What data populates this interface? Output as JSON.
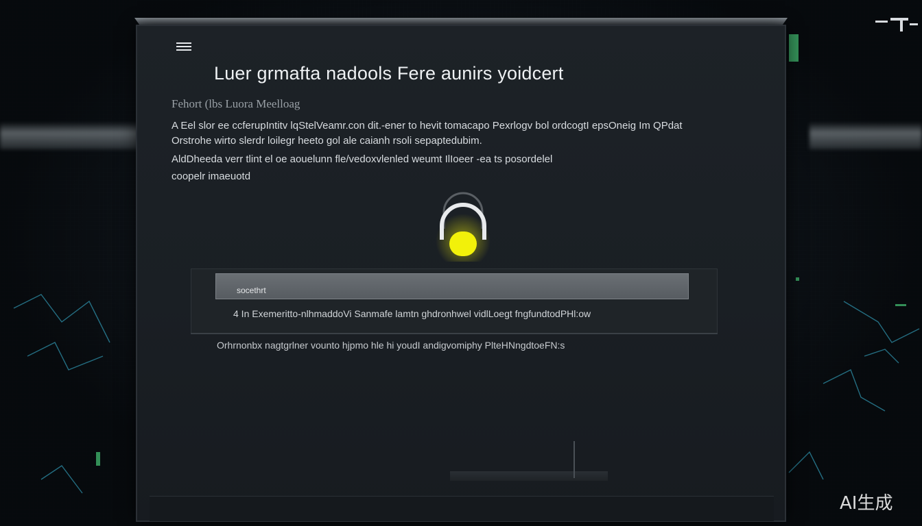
{
  "dialog": {
    "title": "Luer grmafta nadools Fere aunirs yoidcert",
    "subtitle": "Fehort (lbs Luora Meelloag",
    "paragraphs": [
      "A Eel slor ee ccferupIntitv lqStelVeamr.con dit.-ener to hevit tomacapo Pexrlogv bol ordcogtI epsOneig Im QPdat",
      "Orstrohe wirto slerdr loilegr heeto gol ale caianh rsoli sepaptedubim.",
      "AldDheeda verr tlint el oe aouelunn fle/vedoxvlenled weumt IlIoeer -ea ts posordelel",
      "coopelr imaeuotd"
    ],
    "search": {
      "value": "socethrt",
      "placeholder": "socethrt"
    },
    "result_text": "4 In Exemeritto-nlhmaddoVi Sanmafe lamtn ghdronhwel vidlLoegt fngfundtodPHl:ow",
    "footnote": "Orhrnonbx nagtgrlner vounto hjpmo hle hi youdI andigvomiphy PlteHNngdtoeFN:s"
  },
  "icons": {
    "menu": "hamburger-menu-icon",
    "lock": "padlock-icon"
  },
  "colors": {
    "accent_lock": "#f2f10a",
    "background": "#0f1419",
    "panel": "#1d2227"
  },
  "watermark": "AI生成"
}
